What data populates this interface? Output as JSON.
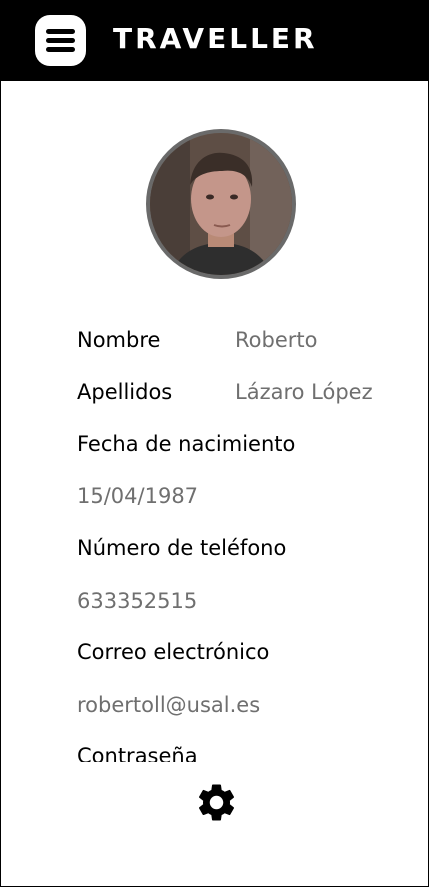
{
  "header": {
    "title": "TRAVELLER"
  },
  "profile": {
    "fields": [
      {
        "label": "Nombre",
        "value": "Roberto"
      },
      {
        "label": "Apellidos",
        "value": "Lázaro López"
      },
      {
        "label": "Fecha de nacimiento",
        "value": "15/04/1987"
      },
      {
        "label": "Número de teléfono",
        "value": "633352515"
      },
      {
        "label": "Correo electrónico",
        "value": "robertoll@usal.es"
      },
      {
        "label": "Contraseña",
        "value": ""
      }
    ]
  },
  "icons": {
    "menu": "menu-icon",
    "settings": "gear-icon"
  }
}
